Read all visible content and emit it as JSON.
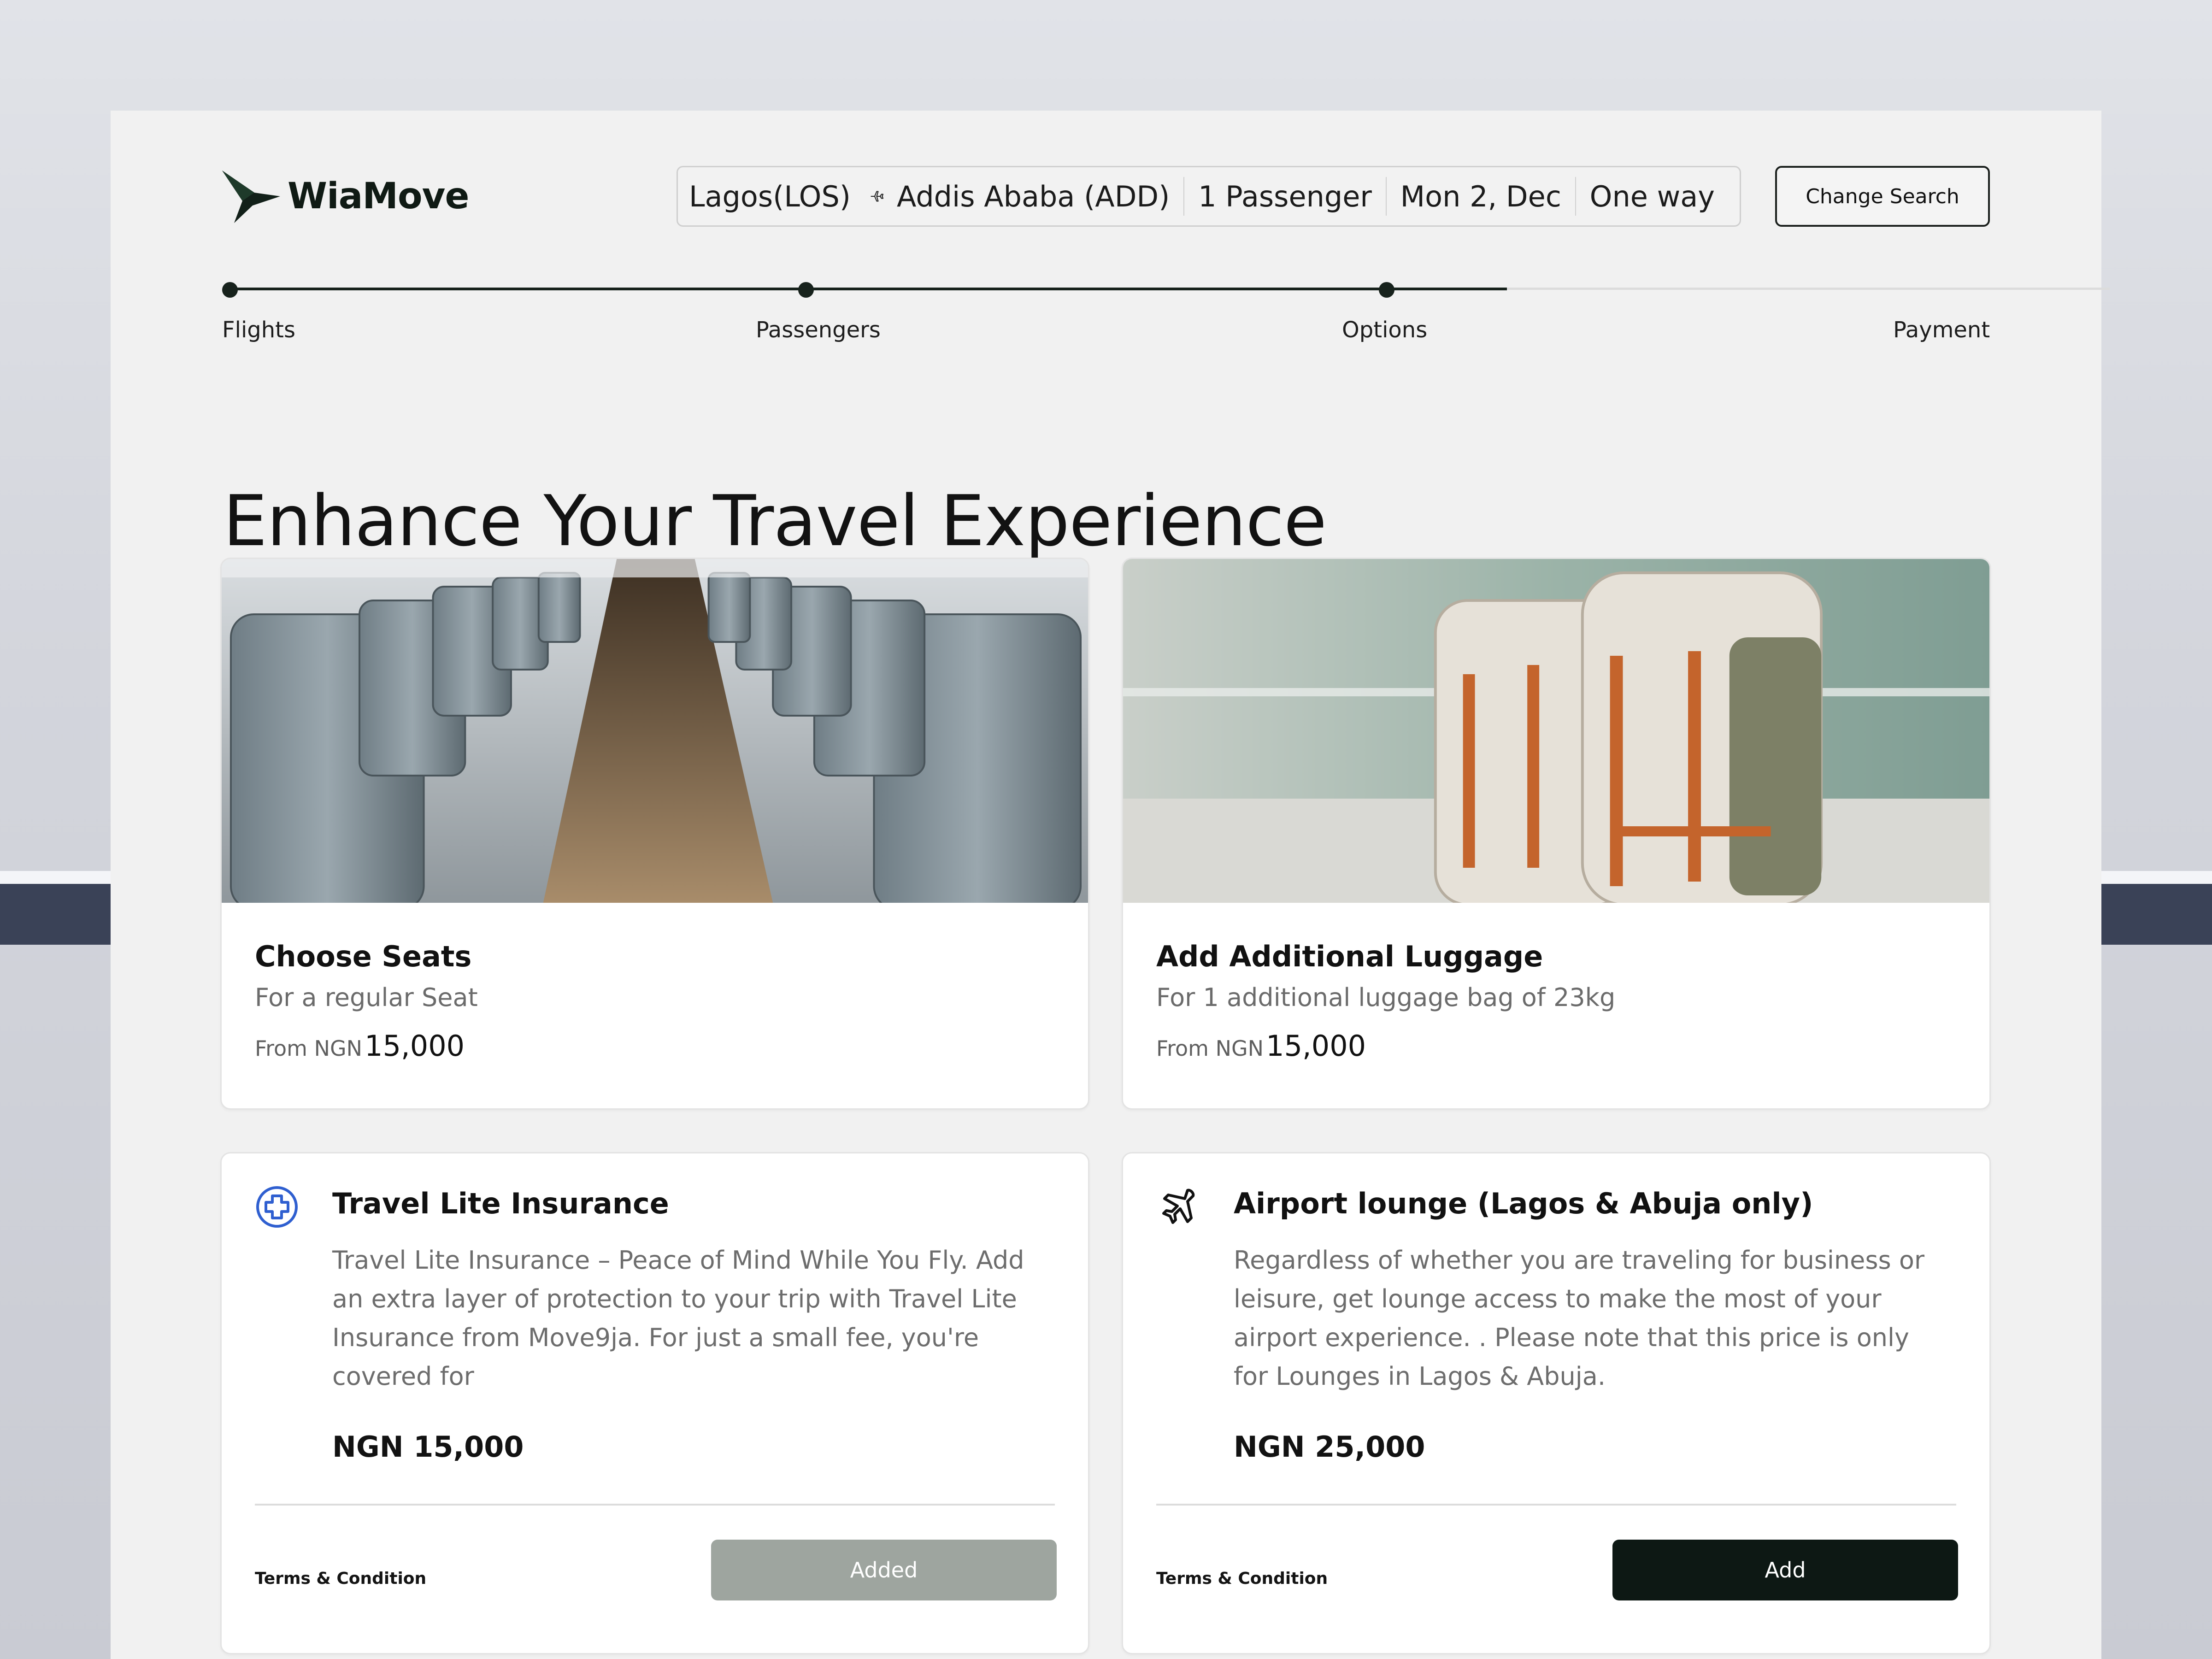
{
  "brand": {
    "name": "WiaMove"
  },
  "search": {
    "origin": "Lagos(LOS)",
    "destination": "Addis Ababa (ADD)",
    "passengers": "1 Passenger",
    "date": "Mon 2, Dec",
    "trip_type": "One way",
    "change_label": "Change Search"
  },
  "steps": [
    {
      "label": "Flights",
      "state": "done"
    },
    {
      "label": "Passengers",
      "state": "done"
    },
    {
      "label": "Options",
      "state": "current"
    },
    {
      "label": "Payment",
      "state": "todo"
    }
  ],
  "page_title": "Enhance Your Travel Experience",
  "extras": [
    {
      "title": "Choose Seats",
      "subtitle": "For a regular Seat",
      "price_prefix": "From NGN",
      "price": "15,000",
      "image": "airplane-seats-photo"
    },
    {
      "title": "Add Additional Luggage",
      "subtitle": "For 1 additional luggage bag of 23kg",
      "price_prefix": "From NGN",
      "price": "15,000",
      "image": "backpacks-at-airport-photo"
    }
  ],
  "options": [
    {
      "icon": "medical-cross-icon",
      "title": "Travel Lite Insurance",
      "description": "Travel Lite Insurance – Peace of Mind While You Fly. Add an extra layer of protection to your trip with Travel Lite Insurance from Move9ja. For just a small fee, you're covered for",
      "price": "NGN 15,000",
      "terms": "Terms & Condition",
      "button": "Added"
    },
    {
      "icon": "airplane-icon",
      "title": "Airport lounge (Lagos & Abuja only)",
      "description": "Regardless of whether you are traveling for business or leisure, get lounge access to make the most of your airport experience. . Please note that this price is only for Lounges in Lagos & Abuja.",
      "price": "NGN 25,000",
      "terms": "Terms & Condition",
      "button": "Add"
    }
  ],
  "colors": {
    "accent": "#0d1814",
    "added": "#9ea59f",
    "panel": "#f1f1f1"
  }
}
